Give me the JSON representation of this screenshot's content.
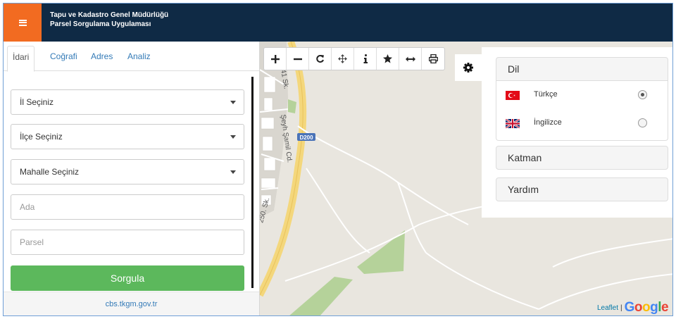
{
  "header": {
    "title_line1": "Tapu ve Kadastro Genel Müdürlüğü",
    "title_line2": "Parsel Sorgulama Uygulaması",
    "menu_icon": "hamburger-menu-icon",
    "accent_color": "#f26b21",
    "bar_color": "#0f2a45"
  },
  "sidebar": {
    "tabs": [
      {
        "label": "İdari",
        "active": true
      },
      {
        "label": "Coğrafi",
        "active": false
      },
      {
        "label": "Adres",
        "active": false
      },
      {
        "label": "Analiz",
        "active": false
      }
    ],
    "province_select": "İl Seçiniz",
    "district_select": "İlçe Seçiniz",
    "neighborhood_select": "Mahalle Seçiniz",
    "block_placeholder": "Ada",
    "parcel_placeholder": "Parsel",
    "search_label": "Sorgula",
    "search_color": "#5cb85c",
    "footer_link": "cbs.tkgm.gov.tr"
  },
  "toolbar": {
    "tools": [
      "zoom-in-icon",
      "zoom-out-icon",
      "refresh-icon",
      "pan-icon",
      "info-icon",
      "star-icon",
      "measure-icon",
      "print-icon"
    ]
  },
  "settings": {
    "gear_icon": "gear-icon",
    "language_header": "Dil",
    "languages": [
      {
        "label": "Türkçe",
        "flag": "turkey-flag-icon",
        "selected": true
      },
      {
        "label": "İngilizce",
        "flag": "uk-flag-icon",
        "selected": false
      }
    ],
    "layer_header": "Katman",
    "help_header": "Yardım"
  },
  "map": {
    "street_labels": [
      "41 Sk.",
      "Şeyh Şamil Cd.",
      "250. Sk."
    ],
    "road_shield": "D200",
    "attribution_leaflet": "Leaflet",
    "attribution_separator": "|",
    "attribution_google": "Google"
  }
}
